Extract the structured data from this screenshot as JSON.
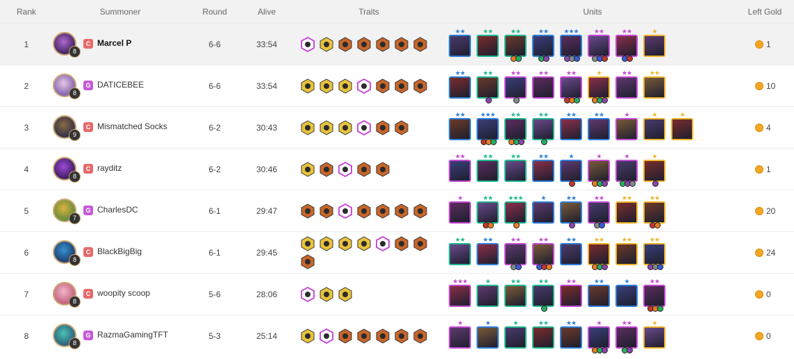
{
  "headers": {
    "rank": "Rank",
    "summoner": "Summoner",
    "round": "Round",
    "alive": "Alive",
    "traits": "Traits",
    "units": "Units",
    "gold": "Left Gold"
  },
  "colors": {
    "tier": {
      "gray": "#9e9e9e",
      "green": "#1fb98f",
      "blue": "#2e7fd8",
      "purple": "#c54ad4",
      "gold": "#f0b429"
    },
    "trait": {
      "bronze": "#c7662b",
      "silver": "#9aa0a6",
      "gold": "#e8c33c",
      "prismatic": "#c94fd8"
    },
    "tag": {
      "C": "#e56a6a",
      "G": "#c55ad6"
    },
    "coin": "#f5a623"
  },
  "rows": [
    {
      "rank": "1",
      "name": "Marcel P",
      "tag": "C",
      "level": "8",
      "round": "6-6",
      "alive": "33:54",
      "gold": "1",
      "traits": [
        "prismatic",
        "gold",
        "bronze",
        "bronze",
        "bronze",
        "bronze",
        "bronze"
      ],
      "units": [
        {
          "tier": "blue",
          "stars": 2,
          "items": 0
        },
        {
          "tier": "green",
          "stars": 2,
          "items": 0
        },
        {
          "tier": "green",
          "stars": 2,
          "items": 2
        },
        {
          "tier": "blue",
          "stars": 2,
          "items": 2
        },
        {
          "tier": "blue",
          "stars": 3,
          "items": 3
        },
        {
          "tier": "purple",
          "stars": 2,
          "items": 3
        },
        {
          "tier": "purple",
          "stars": 2,
          "items": 2
        },
        {
          "tier": "gold",
          "stars": 1,
          "items": 0
        }
      ]
    },
    {
      "rank": "2",
      "name": "DATICEBEE",
      "tag": "G",
      "level": "8",
      "round": "6-6",
      "alive": "33:54",
      "gold": "10",
      "traits": [
        "gold",
        "gold",
        "gold",
        "prismatic",
        "bronze",
        "bronze",
        "bronze"
      ],
      "units": [
        {
          "tier": "blue",
          "stars": 2,
          "items": 0
        },
        {
          "tier": "green",
          "stars": 2,
          "items": 1
        },
        {
          "tier": "purple",
          "stars": 2,
          "items": 1
        },
        {
          "tier": "purple",
          "stars": 2,
          "items": 0
        },
        {
          "tier": "purple",
          "stars": 2,
          "items": 3
        },
        {
          "tier": "gold",
          "stars": 1,
          "items": 3
        },
        {
          "tier": "purple",
          "stars": 2,
          "items": 0
        },
        {
          "tier": "gold",
          "stars": 2,
          "items": 0
        }
      ]
    },
    {
      "rank": "3",
      "name": "Mismatched Socks",
      "tag": "C",
      "level": "9",
      "round": "6-2",
      "alive": "30:43",
      "gold": "4",
      "traits": [
        "gold",
        "gold",
        "gold",
        "prismatic",
        "bronze",
        "bronze"
      ],
      "units": [
        {
          "tier": "blue",
          "stars": 2,
          "items": 0
        },
        {
          "tier": "blue",
          "stars": 3,
          "items": 3
        },
        {
          "tier": "green",
          "stars": 2,
          "items": 3
        },
        {
          "tier": "green",
          "stars": 2,
          "items": 1
        },
        {
          "tier": "blue",
          "stars": 2,
          "items": 0
        },
        {
          "tier": "blue",
          "stars": 2,
          "items": 0
        },
        {
          "tier": "purple",
          "stars": 1,
          "items": 0
        },
        {
          "tier": "gold",
          "stars": 1,
          "items": 0
        },
        {
          "tier": "gold",
          "stars": 1,
          "items": 0
        }
      ]
    },
    {
      "rank": "4",
      "name": "rayditz",
      "tag": "C",
      "level": "8",
      "round": "6-2",
      "alive": "30:46",
      "gold": "1",
      "traits": [
        "gold",
        "bronze",
        "prismatic",
        "bronze",
        "bronze"
      ],
      "units": [
        {
          "tier": "purple",
          "stars": 2,
          "items": 0
        },
        {
          "tier": "green",
          "stars": 2,
          "items": 0
        },
        {
          "tier": "green",
          "stars": 2,
          "items": 0
        },
        {
          "tier": "blue",
          "stars": 2,
          "items": 0
        },
        {
          "tier": "blue",
          "stars": 1,
          "items": 1
        },
        {
          "tier": "purple",
          "stars": 1,
          "items": 3
        },
        {
          "tier": "purple",
          "stars": 1,
          "items": 3
        },
        {
          "tier": "gold",
          "stars": 1,
          "items": 1
        }
      ]
    },
    {
      "rank": "5",
      "name": "CharlesDC",
      "tag": "G",
      "level": "7",
      "round": "6-1",
      "alive": "29:47",
      "gold": "20",
      "traits": [
        "bronze",
        "bronze",
        "prismatic",
        "bronze",
        "bronze",
        "bronze",
        "bronze"
      ],
      "units": [
        {
          "tier": "purple",
          "stars": 1,
          "items": 0
        },
        {
          "tier": "green",
          "stars": 2,
          "items": 2
        },
        {
          "tier": "green",
          "stars": 3,
          "items": 1
        },
        {
          "tier": "blue",
          "stars": 1,
          "items": 0
        },
        {
          "tier": "blue",
          "stars": 2,
          "items": 1
        },
        {
          "tier": "purple",
          "stars": 2,
          "items": 2
        },
        {
          "tier": "gold",
          "stars": 2,
          "items": 0
        },
        {
          "tier": "gold",
          "stars": 2,
          "items": 2
        }
      ]
    },
    {
      "rank": "6",
      "name": "BlackBigBig",
      "tag": "C",
      "level": "8",
      "round": "6-1",
      "alive": "29:45",
      "gold": "24",
      "traits": [
        "gold",
        "gold",
        "gold",
        "gold",
        "prismatic",
        "bronze",
        "bronze",
        "bronze"
      ],
      "units": [
        {
          "tier": "green",
          "stars": 2,
          "items": 0
        },
        {
          "tier": "blue",
          "stars": 2,
          "items": 0
        },
        {
          "tier": "purple",
          "stars": 2,
          "items": 2
        },
        {
          "tier": "purple",
          "stars": 2,
          "items": 3
        },
        {
          "tier": "blue",
          "stars": 2,
          "items": 0
        },
        {
          "tier": "gold",
          "stars": 2,
          "items": 3
        },
        {
          "tier": "gold",
          "stars": 2,
          "items": 0
        },
        {
          "tier": "gold",
          "stars": 2,
          "items": 3
        }
      ]
    },
    {
      "rank": "7",
      "name": "woopity scoop",
      "tag": "C",
      "level": "8",
      "round": "5-6",
      "alive": "28:06",
      "gold": "0",
      "traits": [
        "prismatic",
        "gold",
        "gold"
      ],
      "units": [
        {
          "tier": "purple",
          "stars": 3,
          "items": 0
        },
        {
          "tier": "green",
          "stars": 1,
          "items": 0
        },
        {
          "tier": "green",
          "stars": 2,
          "items": 0
        },
        {
          "tier": "green",
          "stars": 2,
          "items": 1
        },
        {
          "tier": "purple",
          "stars": 2,
          "items": 0
        },
        {
          "tier": "blue",
          "stars": 2,
          "items": 0
        },
        {
          "tier": "blue",
          "stars": 1,
          "items": 0
        },
        {
          "tier": "purple",
          "stars": 2,
          "items": 3
        }
      ]
    },
    {
      "rank": "8",
      "name": "RazmaGamingTFT",
      "tag": "G",
      "level": "8",
      "round": "5-3",
      "alive": "25:14",
      "gold": "0",
      "traits": [
        "gold",
        "prismatic",
        "bronze",
        "bronze",
        "bronze",
        "bronze",
        "bronze"
      ],
      "units": [
        {
          "tier": "purple",
          "stars": 1,
          "items": 0
        },
        {
          "tier": "blue",
          "stars": 1,
          "items": 0
        },
        {
          "tier": "green",
          "stars": 1,
          "items": 0
        },
        {
          "tier": "green",
          "stars": 2,
          "items": 0
        },
        {
          "tier": "blue",
          "stars": 2,
          "items": 0
        },
        {
          "tier": "purple",
          "stars": 1,
          "items": 3
        },
        {
          "tier": "purple",
          "stars": 2,
          "items": 2
        },
        {
          "tier": "gold",
          "stars": 1,
          "items": 0
        }
      ]
    }
  ]
}
